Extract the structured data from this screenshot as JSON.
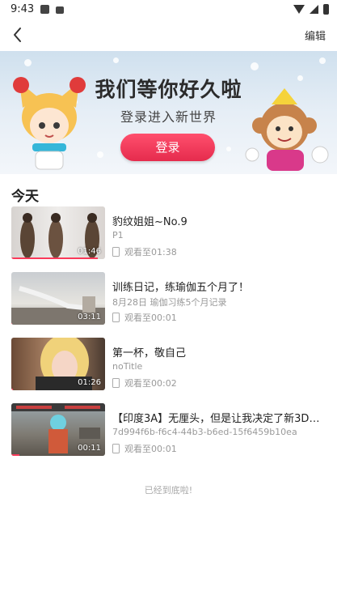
{
  "status_bar": {
    "time": "9:43"
  },
  "header": {
    "edit_label": "编辑",
    "back_icon": "back-arrow-icon"
  },
  "banner": {
    "title": "我们等你好久啦",
    "subtitle": "登录进入新世界",
    "login_label": "登录",
    "accent_color": "#e52b4d"
  },
  "section": {
    "today_label": "今天"
  },
  "history": [
    {
      "title": "豹纹姐姐~No.9",
      "subtitle": "P1",
      "watched": "观看至01:38",
      "duration": "01:46",
      "progress": 0.92
    },
    {
      "title": "训练日记，练瑜伽五个月了！",
      "subtitle": "8月28日 瑜伽习练5个月记录",
      "watched": "观看至00:01",
      "duration": "03:11",
      "progress": 0.01
    },
    {
      "title": "第一杯，敬自己",
      "subtitle": "noTitle",
      "watched": "观看至00:02",
      "duration": "01:26",
      "progress": 0.02
    },
    {
      "title": "【印度3A】无厘头，但是让我决定了新3D的…",
      "subtitle": "7d994f6b-f6c4-44b3-b6ed-15f6459b10ea",
      "watched": "观看至00:01",
      "duration": "00:11",
      "progress": 0.09
    }
  ],
  "footer": {
    "end_label": "已经到底啦!"
  }
}
